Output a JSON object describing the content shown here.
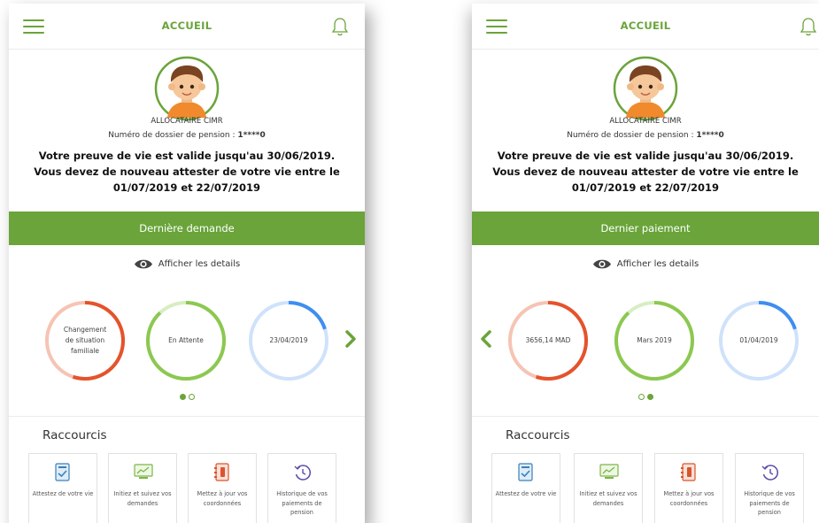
{
  "colors": {
    "brand_green": "#6aa43a",
    "ring_red": "#e4532c",
    "ring_red_light": "#f6c4b4",
    "ring_green": "#8cc850",
    "ring_green_light": "#d7eec2",
    "ring_blue": "#3f8ef0",
    "ring_blue_light": "#cfe2fb"
  },
  "screens": [
    {
      "header": {
        "menu_icon": "hamburger-menu-icon",
        "title": "ACCUEIL",
        "bell_icon": "bell-icon"
      },
      "profile": {
        "avatar_icon": "boy-avatar-icon",
        "role": "ALLOCATAIRE CIMR",
        "dossier_label": "Numéro de dossier de pension : ",
        "dossier_value": "1****0"
      },
      "validity": {
        "line1": "Votre preuve de vie est valide jusqu'au 30/06/2019.",
        "line2": "Vous devez de nouveau attester de votre vie entre le",
        "line3": "01/07/2019 et 22/07/2019"
      },
      "section_title": "Dernière demande",
      "details": {
        "icon": "eye-icon",
        "label": "Afficher les details"
      },
      "rings": [
        {
          "label": "Changement de situation familiale",
          "color": "red",
          "progress": 0.55
        },
        {
          "label": "En Attente",
          "color": "green",
          "progress": 0.88
        },
        {
          "label": "23/04/2019",
          "color": "blue",
          "progress": 0.2
        }
      ],
      "nav": {
        "next": "chevron-right-icon"
      },
      "pager": {
        "active": 0,
        "count": 2
      },
      "shortcuts": {
        "title": "Raccourcis",
        "items": [
          {
            "label": "Attestez de votre vie",
            "icon": "document-check-icon"
          },
          {
            "label": "Initiez et suivez vos demandes",
            "icon": "chart-screen-icon"
          },
          {
            "label": "Mettez à jour vos coordonnées",
            "icon": "address-book-icon"
          },
          {
            "label": "Historique de vos paiements de pension",
            "icon": "history-clock-icon"
          }
        ]
      }
    },
    {
      "header": {
        "menu_icon": "hamburger-menu-icon",
        "title": "ACCUEIL",
        "bell_icon": "bell-icon"
      },
      "profile": {
        "avatar_icon": "boy-avatar-icon",
        "role": "ALLOCATAIRE CIMR",
        "dossier_label": "Numéro de dossier de pension : ",
        "dossier_value": "1****0"
      },
      "validity": {
        "line1": "Votre preuve de vie est valide jusqu'au 30/06/2019.",
        "line2": "Vous devez de nouveau attester de votre vie entre le",
        "line3": "01/07/2019 et 22/07/2019"
      },
      "section_title": "Dernier paiement",
      "details": {
        "icon": "eye-icon",
        "label": "Afficher les details"
      },
      "rings": [
        {
          "label": "3656,14 MAD",
          "color": "red",
          "progress": 0.55
        },
        {
          "label": "Mars 2019",
          "color": "green",
          "progress": 0.88
        },
        {
          "label": "01/04/2019",
          "color": "blue",
          "progress": 0.2
        }
      ],
      "nav": {
        "prev": "chevron-left-icon"
      },
      "pager": {
        "active": 1,
        "count": 2
      },
      "shortcuts": {
        "title": "Raccourcis",
        "items": [
          {
            "label": "Attestez de votre vie",
            "icon": "document-check-icon"
          },
          {
            "label": "Initiez et suivez vos demandes",
            "icon": "chart-screen-icon"
          },
          {
            "label": "Mettez à jour vos coordonnées",
            "icon": "address-book-icon"
          },
          {
            "label": "Historique de vos paiements de pension",
            "icon": "history-clock-icon"
          }
        ]
      }
    }
  ]
}
